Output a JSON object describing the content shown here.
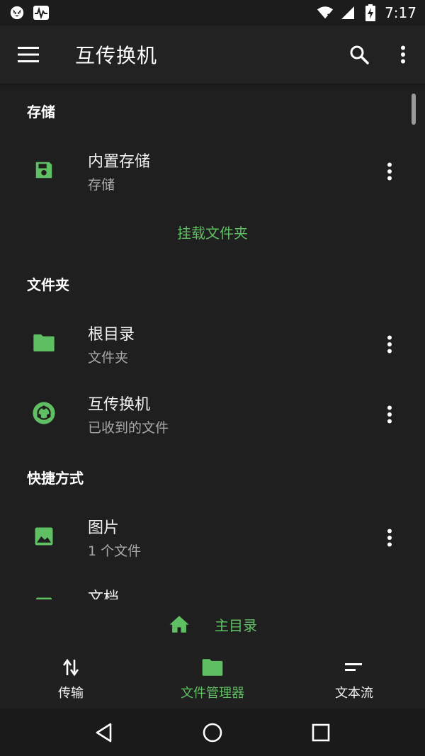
{
  "status_bar": {
    "time": "7:17",
    "icons": [
      "cat-face-icon",
      "pulse-icon",
      "wifi-icon",
      "signal-icon",
      "battery-charging-icon"
    ]
  },
  "app_bar": {
    "title": "互传换机",
    "actions": [
      "menu-icon",
      "search-icon",
      "more-vert-icon"
    ]
  },
  "colors": {
    "accent": "#5fbf63",
    "background": "#1f1f1f",
    "app_bar": "#222222"
  },
  "sections": {
    "storage": {
      "header": "存储",
      "items": [
        {
          "title": "内置存储",
          "subtitle": "存储",
          "icon": "sd-card-icon"
        }
      ],
      "mount_link": "挂载文件夹"
    },
    "folders": {
      "header": "文件夹",
      "items": [
        {
          "title": "根目录",
          "subtitle": "文件夹",
          "icon": "folder-icon"
        },
        {
          "title": "互传换机",
          "subtitle": "已收到的文件",
          "icon": "app-logo-icon"
        }
      ]
    },
    "shortcuts": {
      "header": "快捷方式",
      "items": [
        {
          "title": "图片",
          "subtitle": "1 个文件",
          "icon": "image-icon"
        },
        {
          "title": "文档",
          "subtitle": "",
          "icon": "document-icon"
        }
      ]
    }
  },
  "home_bar": {
    "label": "主目录",
    "icon": "home-icon"
  },
  "bottom_nav": {
    "items": [
      {
        "label": "传输",
        "icon": "transfer-arrows-icon",
        "active": false
      },
      {
        "label": "文件管理器",
        "icon": "folder-icon",
        "active": true
      },
      {
        "label": "文本流",
        "icon": "short-text-icon",
        "active": false
      }
    ]
  },
  "system_nav": [
    "back-icon",
    "home-circle-icon",
    "recents-icon"
  ]
}
